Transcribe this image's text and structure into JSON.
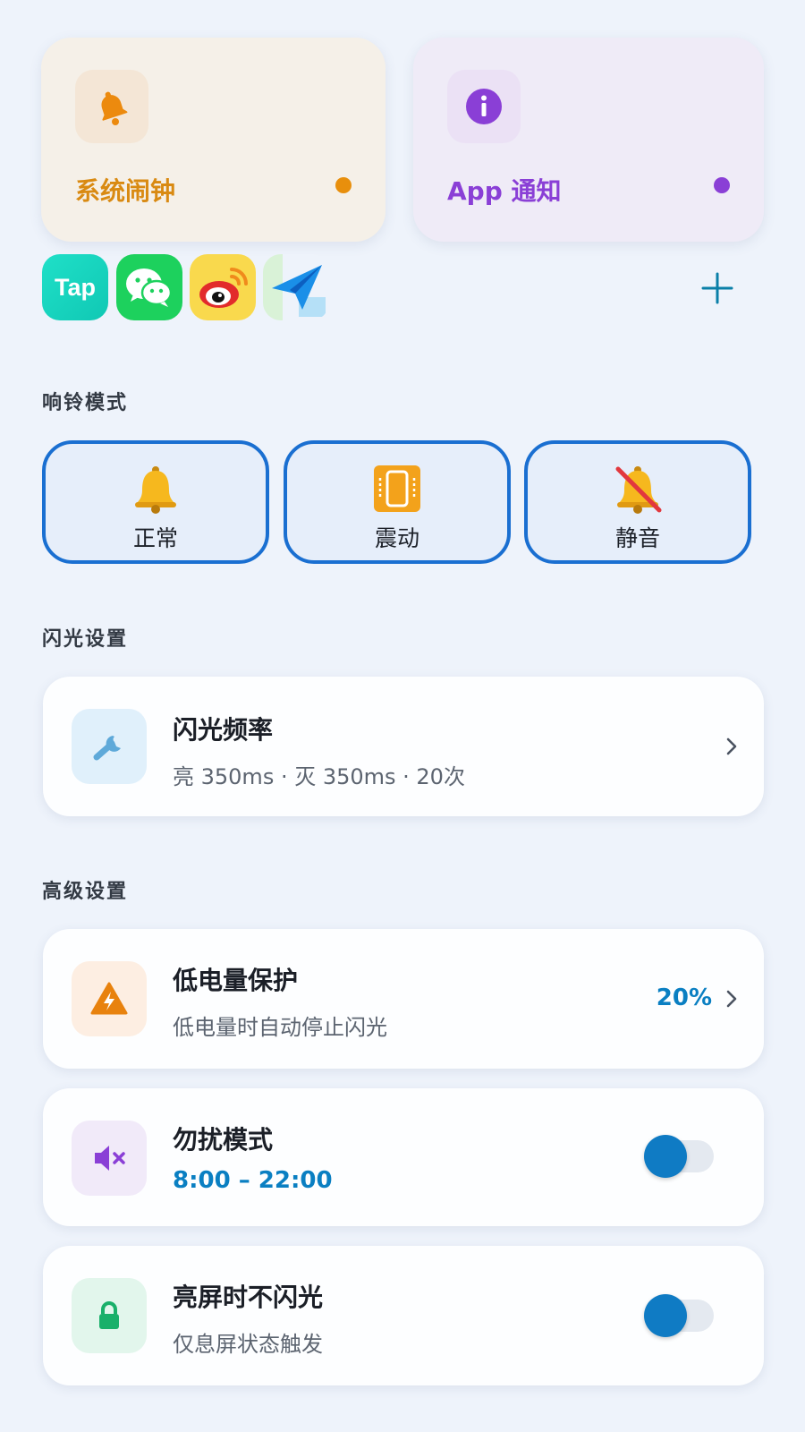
{
  "sources": {
    "alarm": {
      "label": "系统闹钟",
      "icon": "bell-icon",
      "color": "#d98a12"
    },
    "app": {
      "label": "App 通知",
      "icon": "info-icon",
      "color": "#8a3fd6"
    }
  },
  "app_icons": [
    {
      "name": "taptap-icon",
      "text": "Tap"
    },
    {
      "name": "wechat-icon"
    },
    {
      "name": "weibo-icon"
    },
    {
      "name": "paper-plane-icon"
    }
  ],
  "add_icon": "plus-icon",
  "ring_mode": {
    "title": "响铃模式",
    "modes": [
      {
        "label": "正常",
        "icon": "bell-emoji-icon"
      },
      {
        "label": "震动",
        "icon": "vibrate-emoji-icon"
      },
      {
        "label": "静音",
        "icon": "muted-bell-emoji-icon"
      }
    ]
  },
  "flash": {
    "title": "闪光设置",
    "frequency": {
      "title": "闪光频率",
      "subtitle": "亮 350ms · 灭 350ms · 20次",
      "icon": "wrench-icon"
    }
  },
  "advanced": {
    "title": "高级设置",
    "low_battery": {
      "title": "低电量保护",
      "subtitle": "低电量时自动停止闪光",
      "value": "20%",
      "icon": "warning-icon"
    },
    "dnd": {
      "title": "勿扰模式",
      "subtitle": "8:00 – 22:00",
      "enabled": true,
      "icon": "mute-speaker-icon"
    },
    "screen_on": {
      "title": "亮屏时不闪光",
      "subtitle": "仅息屏状态触发",
      "enabled": true,
      "icon": "lock-icon"
    }
  },
  "colors": {
    "accent": "#0a7fc2",
    "mode_border": "#1a6fd1",
    "alarm": "#e88f0c",
    "app": "#8a3fd6"
  }
}
